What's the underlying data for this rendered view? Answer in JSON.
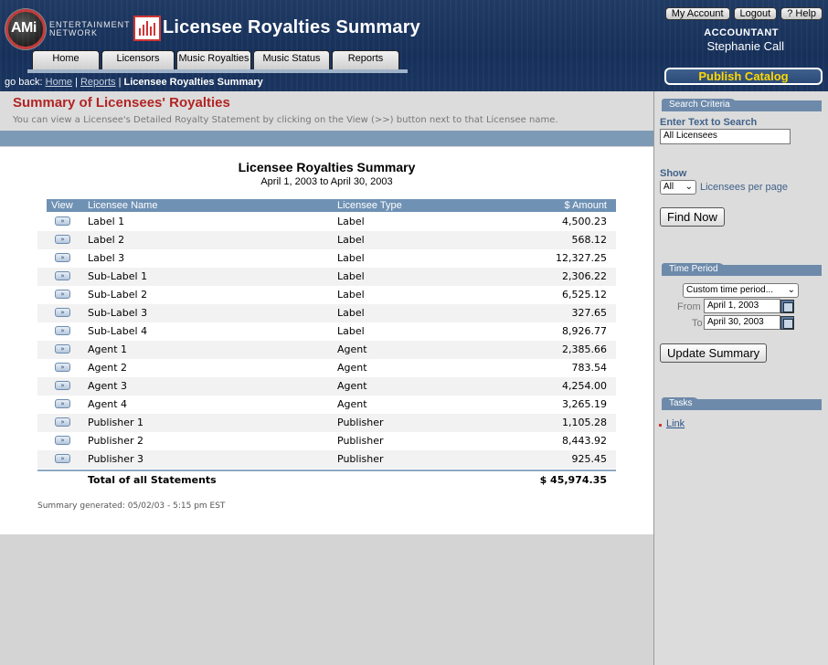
{
  "brand": {
    "logo": "AMi",
    "sub_line1": "ENTERTAINMENT",
    "sub_line2": "NETWORK"
  },
  "app_title": "Licensee Royalties Summary",
  "nav": {
    "tabs": [
      "Home",
      "Licensors",
      "Music Royalties",
      "Music Status",
      "Reports"
    ]
  },
  "account": {
    "my_account": "My Account",
    "logout": "Logout",
    "help": "? Help",
    "role": "ACCOUNTANT",
    "name": "Stephanie Call"
  },
  "publish_label": "Publish Catalog",
  "breadcrumb": {
    "prefix": "go back:",
    "home": "Home",
    "reports": "Reports",
    "current": "Licensee Royalties Summary"
  },
  "page": {
    "heading": "Summary of Licensees' Royalties",
    "intro": "You can view a Licensee's Detailed Royalty Statement by clicking on the View (>>) button next to that Licensee name."
  },
  "report": {
    "title": "Licensee Royalties Summary",
    "period": "April 1, 2003 to April 30, 2003",
    "columns": {
      "view": "View",
      "name": "Licensee Name",
      "type": "Licensee Type",
      "amount": "$ Amount"
    },
    "view_glyph": "»",
    "rows": [
      {
        "name": "Label 1",
        "type": "Label",
        "amount": "4,500.23"
      },
      {
        "name": "Label 2",
        "type": "Label",
        "amount": "568.12"
      },
      {
        "name": "Label 3",
        "type": "Label",
        "amount": "12,327.25"
      },
      {
        "name": "Sub-Label 1",
        "type": "Label",
        "amount": "2,306.22"
      },
      {
        "name": "Sub-Label 2",
        "type": "Label",
        "amount": "6,525.12"
      },
      {
        "name": "Sub-Label 3",
        "type": "Label",
        "amount": "327.65"
      },
      {
        "name": "Sub-Label 4",
        "type": "Label",
        "amount": "8,926.77"
      },
      {
        "name": "Agent 1",
        "type": "Agent",
        "amount": "2,385.66"
      },
      {
        "name": "Agent 2",
        "type": "Agent",
        "amount": "783.54"
      },
      {
        "name": "Agent 3",
        "type": "Agent",
        "amount": "4,254.00"
      },
      {
        "name": "Agent 4",
        "type": "Agent",
        "amount": "3,265.19"
      },
      {
        "name": "Publisher 1",
        "type": "Publisher",
        "amount": "1,105.28"
      },
      {
        "name": "Publisher 2",
        "type": "Publisher",
        "amount": "8,443.92"
      },
      {
        "name": "Publisher 3",
        "type": "Publisher",
        "amount": "925.45"
      }
    ],
    "total_label": "Total of all Statements",
    "total_value": "$ 45,974.35",
    "generated": "Summary generated: 05/02/03 - 5:15 pm EST"
  },
  "sidebar": {
    "search_header": "Search Criteria",
    "search_label": "Enter Text to Search",
    "search_value": "All Licensees",
    "show_label": "Show",
    "show_value": "All",
    "show_suffix": "Licensees per page",
    "find_button": "Find Now",
    "time_header": "Time Period",
    "time_select": "Custom time period...",
    "from_label": "From",
    "from_value": "April 1, 2003",
    "to_label": "To",
    "to_value": "April 30, 2003",
    "update_button": "Update Summary",
    "tasks_header": "Tasks",
    "task_link": "Link"
  },
  "colors": {
    "header_bg": "#1f3a63",
    "accent_red": "#b32424",
    "publish_text": "#ffd800",
    "table_header": "#6f91b4",
    "sidebar_text": "#40628a"
  }
}
